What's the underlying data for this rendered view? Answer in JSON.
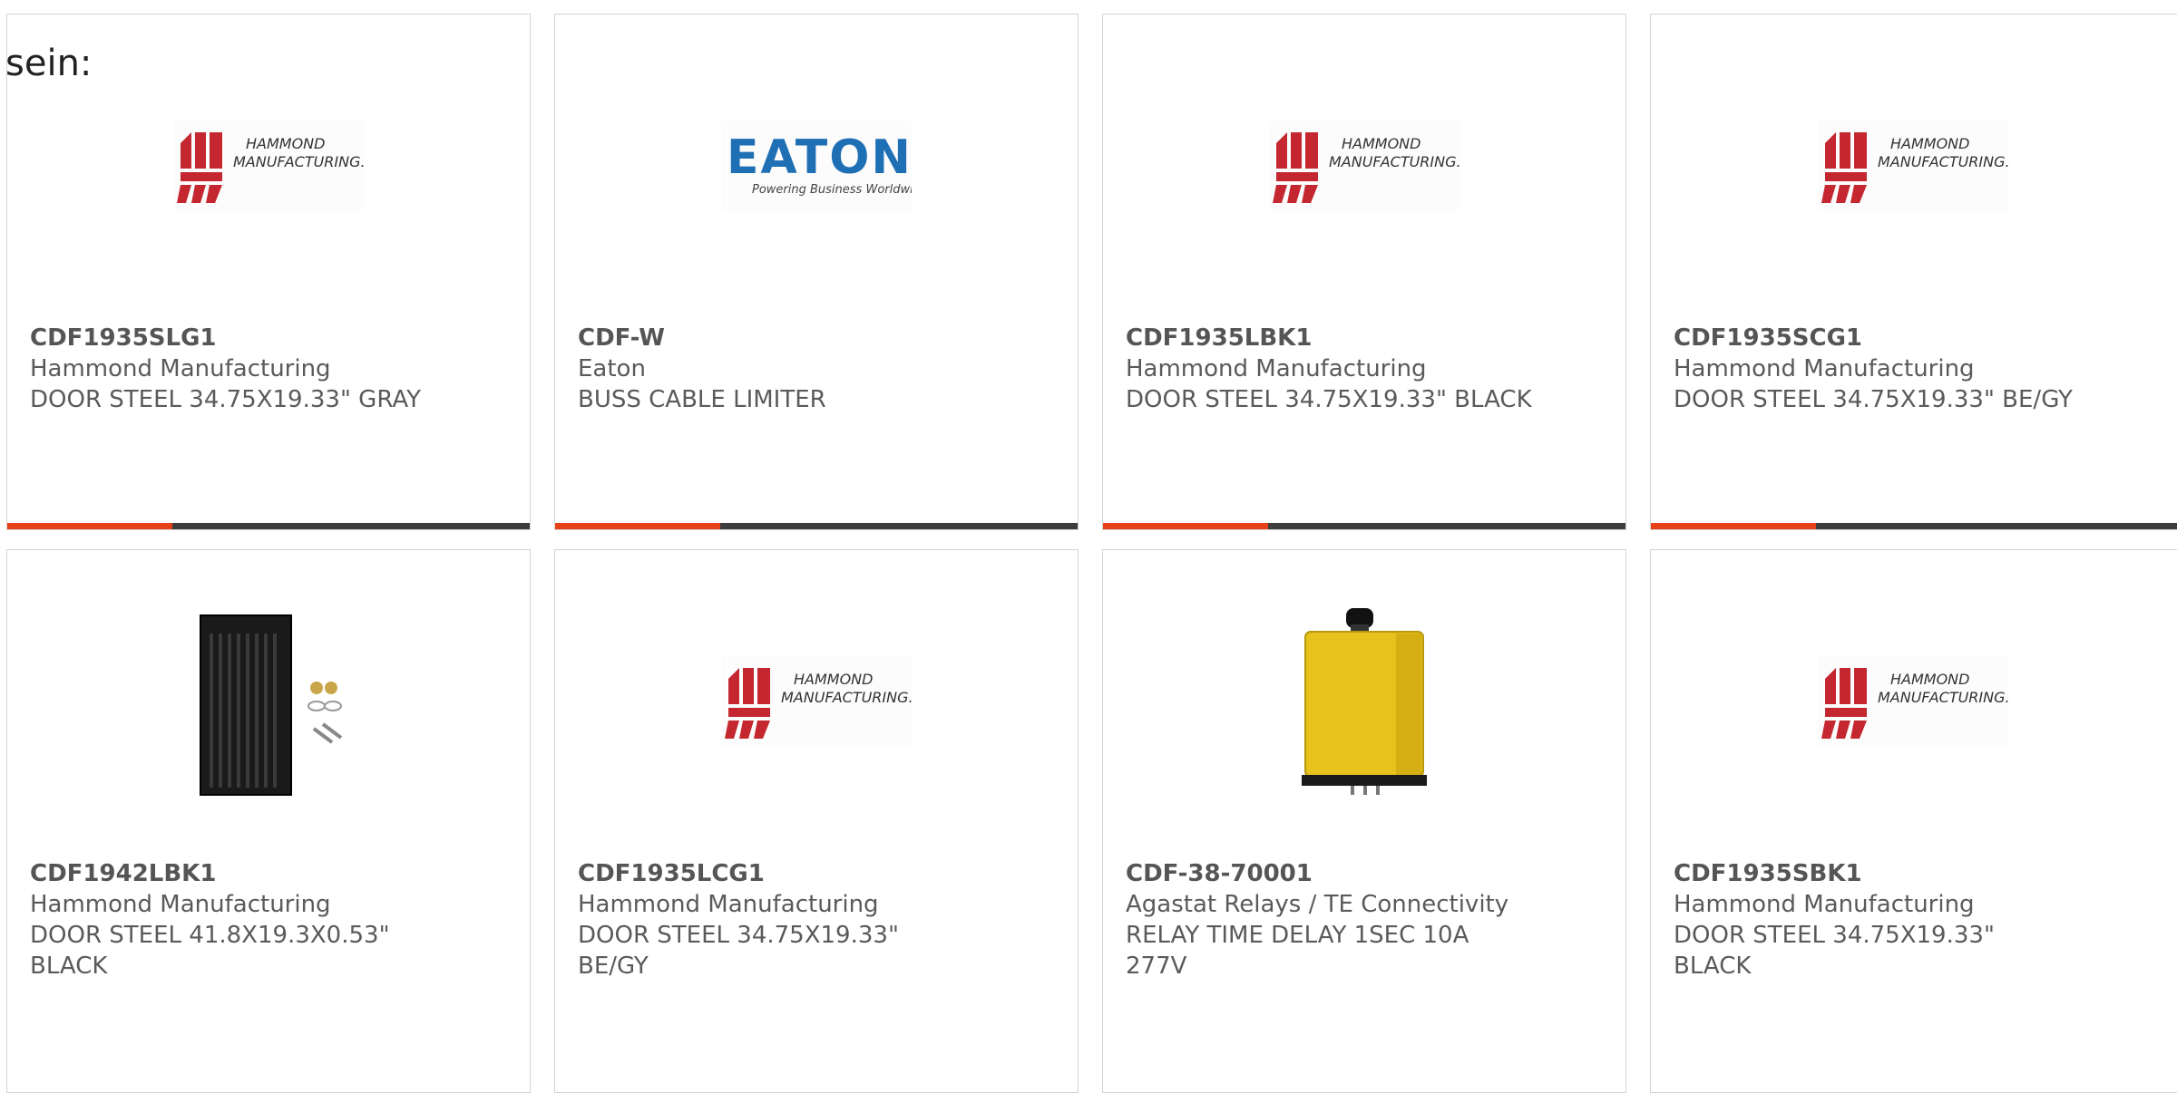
{
  "intro_text": "sein:",
  "colors": {
    "accent": "#e8411a",
    "bar_dark": "#3d3d3d",
    "hammond_red": "#c4272f",
    "eaton_blue": "#1f6fb5",
    "relay_yellow": "#e7c21c"
  },
  "products": [
    {
      "part": "CDF1935SLG1",
      "manufacturer": "Hammond Manufacturing",
      "description": "DOOR STEEL 34.75X19.33\" GRAY",
      "image": "hammond-logo"
    },
    {
      "part": "CDF-W",
      "manufacturer": "Eaton",
      "description": "BUSS CABLE LIMITER",
      "image": "eaton-logo"
    },
    {
      "part": "CDF1935LBK1",
      "manufacturer": "Hammond Manufacturing",
      "description": "DOOR STEEL 34.75X19.33\" BLACK",
      "image": "hammond-logo"
    },
    {
      "part": "CDF1935SCG1",
      "manufacturer": "Hammond Manufacturing",
      "description": "DOOR STEEL 34.75X19.33\" BE/GY",
      "image": "hammond-logo"
    },
    {
      "part": "CDF1942LBK1",
      "manufacturer": "Hammond Manufacturing",
      "description": "DOOR STEEL 41.8X19.3X0.53\" BLACK",
      "image": "black-door-photo"
    },
    {
      "part": "CDF1935LCG1",
      "manufacturer": "Hammond Manufacturing",
      "description": "DOOR STEEL 34.75X19.33\" BE/GY",
      "image": "hammond-logo"
    },
    {
      "part": "CDF-38-70001",
      "manufacturer": "Agastat Relays / TE Connectivity",
      "description": "RELAY TIME DELAY 1SEC 10A 277V",
      "image": "yellow-relay-photo"
    },
    {
      "part": "CDF1935SBK1",
      "manufacturer": "Hammond Manufacturing",
      "description": "DOOR STEEL 34.75X19.33\" BLACK",
      "image": "hammond-logo"
    }
  ],
  "logo_text": {
    "hammond_line1": "HAMMOND",
    "hammond_line2": "MANUFACTURING.",
    "eaton_name": "EATON",
    "eaton_tagline": "Powering Business Worldwide"
  }
}
